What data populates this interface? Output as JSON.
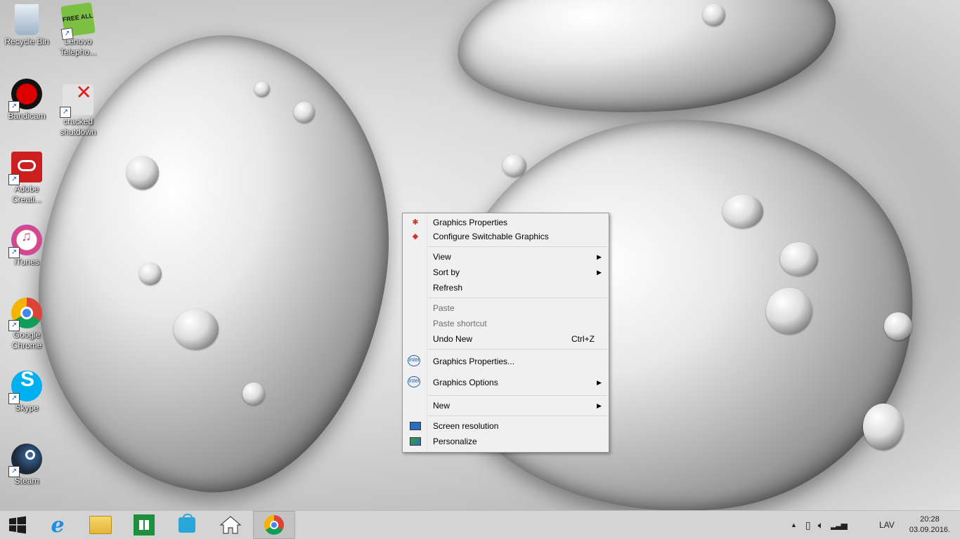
{
  "desktop": {
    "icons": [
      {
        "label": "Recycle Bin",
        "icon": "recycle-bin-icon"
      },
      {
        "label": "Lenovo Telepho...",
        "icon": "lenovo-telephony-icon",
        "badge": "FREE ALL"
      },
      {
        "label": "Bandicam",
        "icon": "bandicam-icon"
      },
      {
        "label": "cracked shutdown",
        "icon": "cracked-shutdown-icon"
      },
      {
        "label": "Adobe Creati...",
        "icon": "adobe-creative-cloud-icon"
      },
      {
        "label": "iTunes",
        "icon": "itunes-icon"
      },
      {
        "label": "Google Chrome",
        "icon": "google-chrome-icon"
      },
      {
        "label": "Skype",
        "icon": "skype-icon"
      },
      {
        "label": "Steam",
        "icon": "steam-icon"
      }
    ]
  },
  "context_menu": {
    "items": {
      "graphics_properties_top": "Graphics Properties",
      "configure_switchable": "Configure Switchable Graphics",
      "view": "View",
      "sort_by": "Sort by",
      "refresh": "Refresh",
      "paste": "Paste",
      "paste_shortcut": "Paste shortcut",
      "undo_new": "Undo New",
      "undo_new_shortcut": "Ctrl+Z",
      "intel_graphics_properties": "Graphics Properties...",
      "intel_graphics_options": "Graphics Options",
      "new": "New",
      "screen_resolution": "Screen resolution",
      "personalize": "Personalize"
    },
    "intel_logo_text": "intel"
  },
  "taskbar": {
    "buttons": [
      "start-icon",
      "internet-explorer-icon",
      "file-explorer-icon",
      "windows-store-icon",
      "store-bag-icon",
      "home-icon",
      "google-chrome-icon"
    ],
    "tray": {
      "language": "LAV",
      "time": "20:28",
      "date": "03.09.2016."
    }
  },
  "colors": {
    "taskbar_bg": "#d4d4d4",
    "menu_bg": "#f0f0f0",
    "disabled_text": "#6d6d6d"
  }
}
